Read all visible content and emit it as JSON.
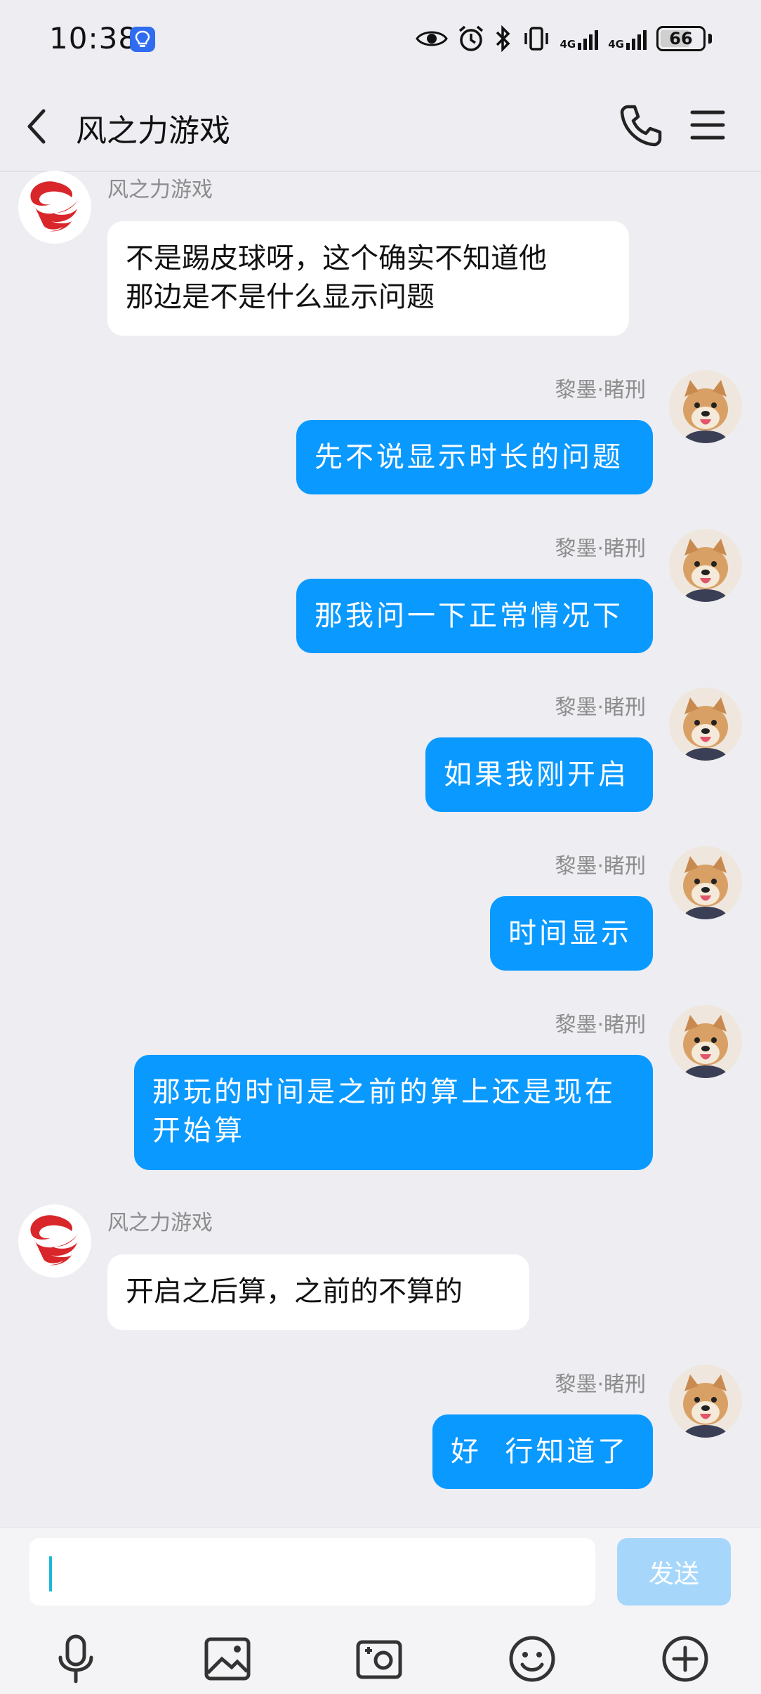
{
  "status_bar": {
    "time": "10:38",
    "network_1": "4G",
    "network_2": "4G",
    "battery": "66",
    "icons": [
      "lightbulb-icon",
      "eye-icon",
      "alarm-icon",
      "bluetooth-icon",
      "vibrate-icon",
      "signal-icon",
      "signal-icon",
      "battery-icon"
    ]
  },
  "header": {
    "title": "风之力游戏",
    "icons": [
      "back-icon",
      "phone-icon",
      "menu-icon"
    ]
  },
  "messages": [
    {
      "direction": "in",
      "sender": "风之力游戏",
      "text": "不是踢皮球呀，这个确实不知道他\n那边是不是什么显示问题"
    },
    {
      "direction": "out",
      "sender": "黎墨·睹刑",
      "text": "先不说显示时长的问题"
    },
    {
      "direction": "out",
      "sender": "黎墨·睹刑",
      "text": "那我问一下正常情况下"
    },
    {
      "direction": "out",
      "sender": "黎墨·睹刑",
      "text": "如果我刚开启"
    },
    {
      "direction": "out",
      "sender": "黎墨·睹刑",
      "text": "时间显示"
    },
    {
      "direction": "out",
      "sender": "黎墨·睹刑",
      "text": "那玩的时间是之前的算上还是现在\n开始算"
    },
    {
      "direction": "in",
      "sender": "风之力游戏",
      "text": "开启之后算，之前的不算的"
    },
    {
      "direction": "out",
      "sender": "黎墨·睹刑",
      "text": "好  行知道了"
    }
  ],
  "input": {
    "value": "",
    "send_label": "发送"
  },
  "toolbar": [
    "microphone-icon",
    "image-icon",
    "camera-icon",
    "emoji-icon",
    "plus-icon"
  ],
  "colors": {
    "outgoing_bubble": "#0a99ff",
    "incoming_bubble": "#ffffff",
    "background": "#ededf2",
    "send_button_disabled": "#a6d7fb"
  }
}
